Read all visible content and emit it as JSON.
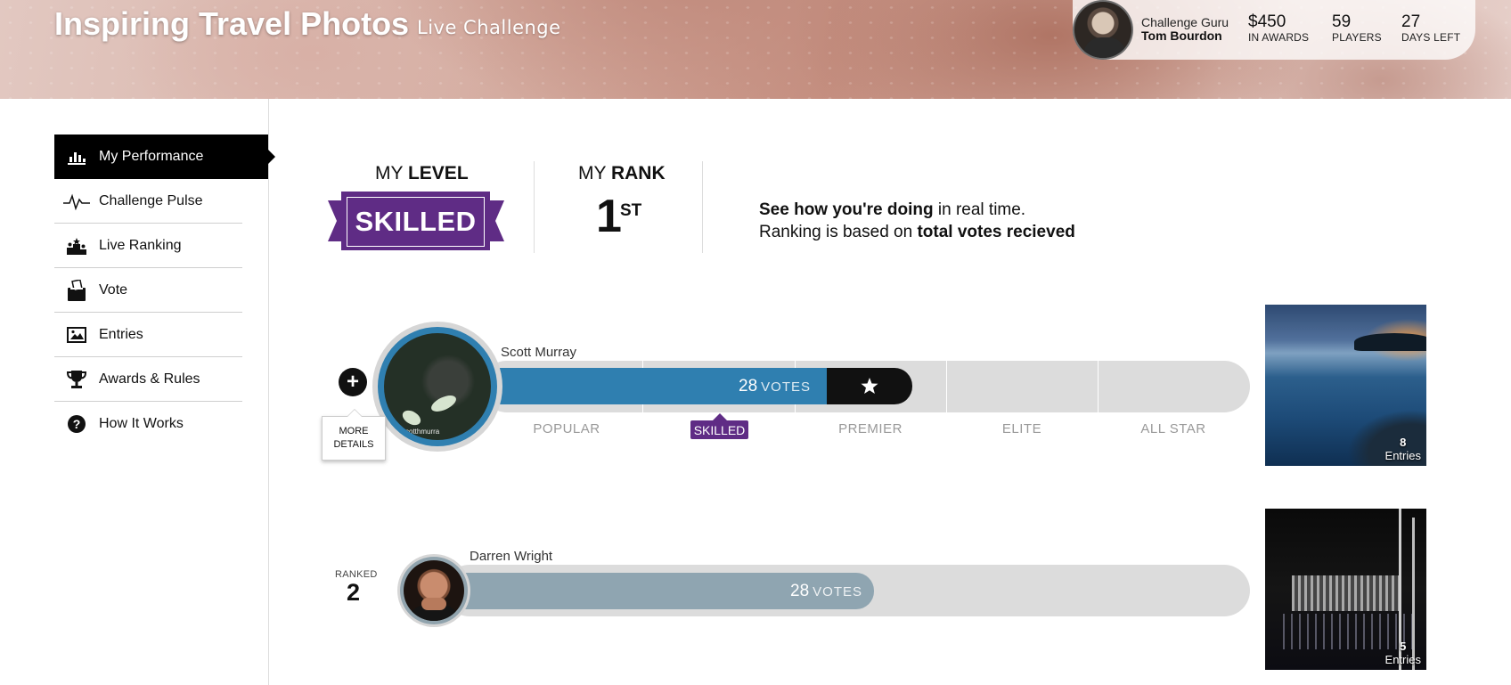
{
  "header": {
    "title": "Inspiring Travel Photos",
    "subtitle": "Live Challenge",
    "guru_label": "Challenge Guru",
    "guru_name": "Tom Bourdon",
    "stats": [
      {
        "value": "$450",
        "label": "IN AWARDS"
      },
      {
        "value": "59",
        "label": "PLAYERS"
      },
      {
        "value": "27",
        "label": "DAYS LEFT"
      }
    ]
  },
  "sidebar": {
    "items": [
      {
        "label": "My Performance",
        "icon": "bar-chart-icon",
        "active": true
      },
      {
        "label": "Challenge Pulse",
        "icon": "pulse-icon"
      },
      {
        "label": "Live Ranking",
        "icon": "podium-icon"
      },
      {
        "label": "Vote",
        "icon": "ballot-box-icon"
      },
      {
        "label": "Entries",
        "icon": "image-icon"
      },
      {
        "label": "Awards & Rules",
        "icon": "trophy-icon"
      },
      {
        "label": "How It Works",
        "icon": "question-icon"
      }
    ]
  },
  "summary": {
    "level_prefix": "MY",
    "level_word": "LEVEL",
    "level_value": "SKILLED",
    "rank_prefix": "MY",
    "rank_word": "RANK",
    "rank_number": "1",
    "rank_suffix": "ST",
    "info_line1_bold": "See how you're doing",
    "info_line1_rest": " in real time.",
    "info_line2_rest": "Ranking is based on ",
    "info_line2_bold": "total votes recieved"
  },
  "levels": [
    "POPULAR",
    "SKILLED",
    "PREMIER",
    "ELITE",
    "ALL STAR"
  ],
  "current_level_index": 1,
  "rows": [
    {
      "name": "Scott Murray",
      "votes": "28",
      "votes_label": "VOTES",
      "more_details": [
        "MORE",
        "DETAILS"
      ],
      "avatar_caption": "scotthmurra",
      "entries_count": "8",
      "entries_label": "Entries"
    },
    {
      "ranked_label": "RANKED",
      "rank": "2",
      "name": "Darren Wright",
      "votes": "28",
      "votes_label": "VOTES",
      "entries_count": "5",
      "entries_label": "Entries"
    }
  ],
  "colors": {
    "brand_purple": "#5f2c85",
    "my_bar_blue": "#2f7fb0",
    "other_bar": "#8fa5b1",
    "track_gray": "#dcdcdc"
  }
}
